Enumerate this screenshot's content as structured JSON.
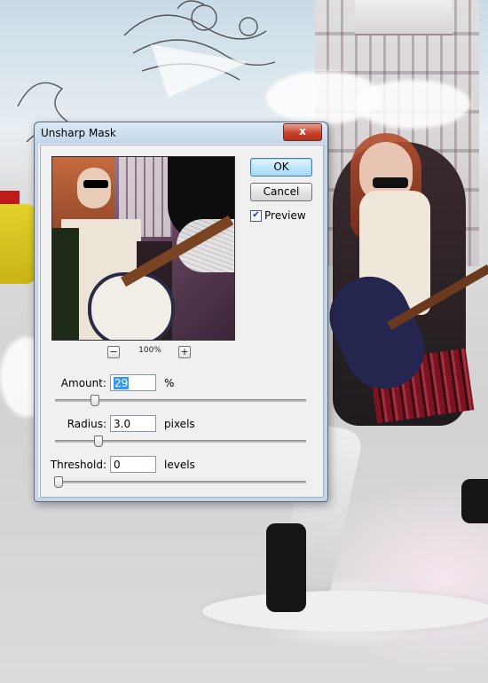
{
  "dialog": {
    "title": "Unsharp Mask",
    "close_label": "x",
    "ok_label": "OK",
    "cancel_label": "Cancel",
    "preview_label": "Preview",
    "preview_checked": true,
    "zoom": {
      "zoom_out_label": "−",
      "zoom_level": "100%",
      "zoom_in_label": "+"
    },
    "amount": {
      "label": "Amount:",
      "value": "29",
      "unit": "%",
      "slider_fraction": 0.145
    },
    "radius": {
      "label": "Radius:",
      "value": "3.0",
      "unit": "pixels",
      "slider_fraction": 0.16
    },
    "threshold": {
      "label": "Threshold:",
      "value": "0",
      "unit": "levels",
      "slider_fraction": 0.0
    }
  },
  "icons": {
    "close": "close-icon",
    "checkbox": "check-icon"
  },
  "colors": {
    "title_bar": "#c3d6ea",
    "close_button": "#c7432c",
    "selection": "#3399ff"
  }
}
